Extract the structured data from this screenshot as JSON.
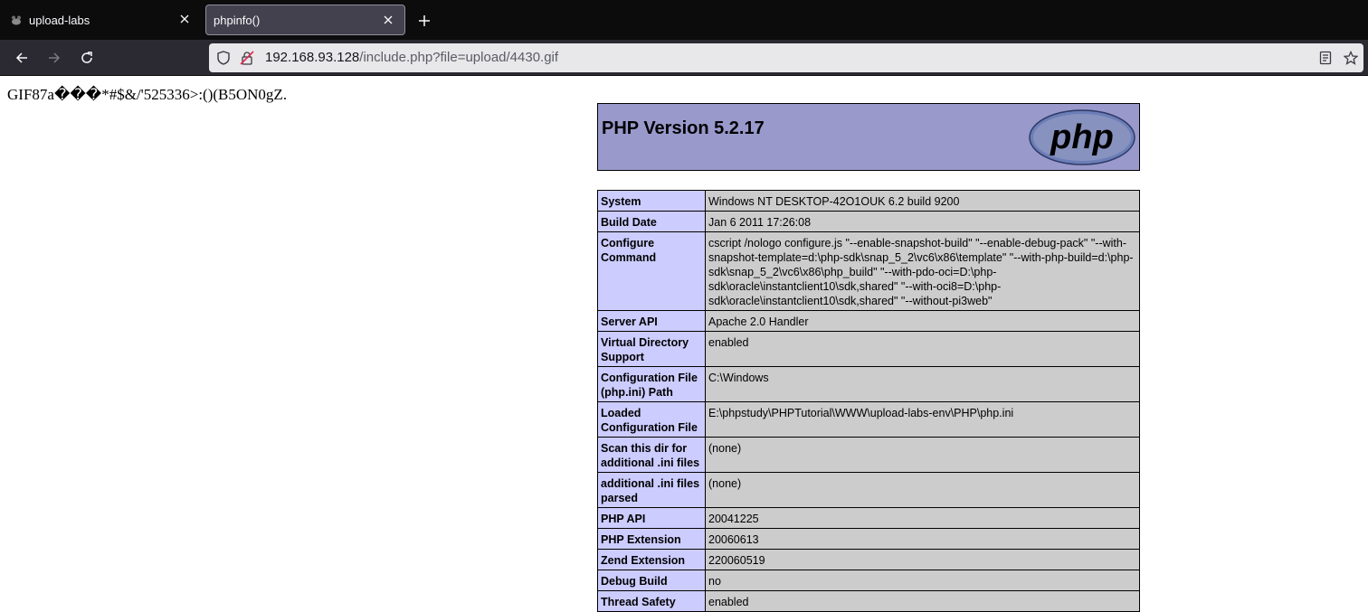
{
  "browser": {
    "tabs": [
      {
        "title": "upload-labs",
        "active": false,
        "icon": "tab-favicon"
      },
      {
        "title": "phpinfo()",
        "active": true
      }
    ],
    "address": {
      "host": "192.168.93.128",
      "path": "/include.php?file=upload/4430.gif"
    }
  },
  "page": {
    "gif_header": "GIF87a���*#$&/'525336>:()(B5ON0gZ.",
    "php_version": "PHP Version 5.2.17",
    "php_logo_text": "php",
    "rows": [
      {
        "label": "System",
        "value": "Windows NT DESKTOP-42O1OUK 6.2 build 9200"
      },
      {
        "label": "Build Date",
        "value": "Jan 6 2011 17:26:08"
      },
      {
        "label": "Configure Command",
        "value": "cscript /nologo configure.js \"--enable-snapshot-build\" \"--enable-debug-pack\" \"--with-snapshot-template=d:\\php-sdk\\snap_5_2\\vc6\\x86\\template\" \"--with-php-build=d:\\php-sdk\\snap_5_2\\vc6\\x86\\php_build\" \"--with-pdo-oci=D:\\php-sdk\\oracle\\instantclient10\\sdk,shared\" \"--with-oci8=D:\\php-sdk\\oracle\\instantclient10\\sdk,shared\" \"--without-pi3web\""
      },
      {
        "label": "Server API",
        "value": "Apache 2.0 Handler"
      },
      {
        "label": "Virtual Directory Support",
        "value": "enabled"
      },
      {
        "label": "Configuration File (php.ini) Path",
        "value": "C:\\Windows"
      },
      {
        "label": "Loaded Configuration File",
        "value": "E:\\phpstudy\\PHPTutorial\\WWW\\upload-labs-env\\PHP\\php.ini"
      },
      {
        "label": "Scan this dir for additional .ini files",
        "value": "(none)"
      },
      {
        "label": "additional .ini files parsed",
        "value": "(none)"
      },
      {
        "label": "PHP API",
        "value": "20041225"
      },
      {
        "label": "PHP Extension",
        "value": "20060613"
      },
      {
        "label": "Zend Extension",
        "value": "220060519"
      },
      {
        "label": "Debug Build",
        "value": "no"
      },
      {
        "label": "Thread Safety",
        "value": "enabled"
      }
    ]
  },
  "colors": {
    "header_bg": "#9999cc",
    "label_bg": "#ccccff",
    "value_bg": "#cccccc",
    "tabbar_bg": "#0c0c0d",
    "toolbar_bg": "#2b2a33"
  }
}
